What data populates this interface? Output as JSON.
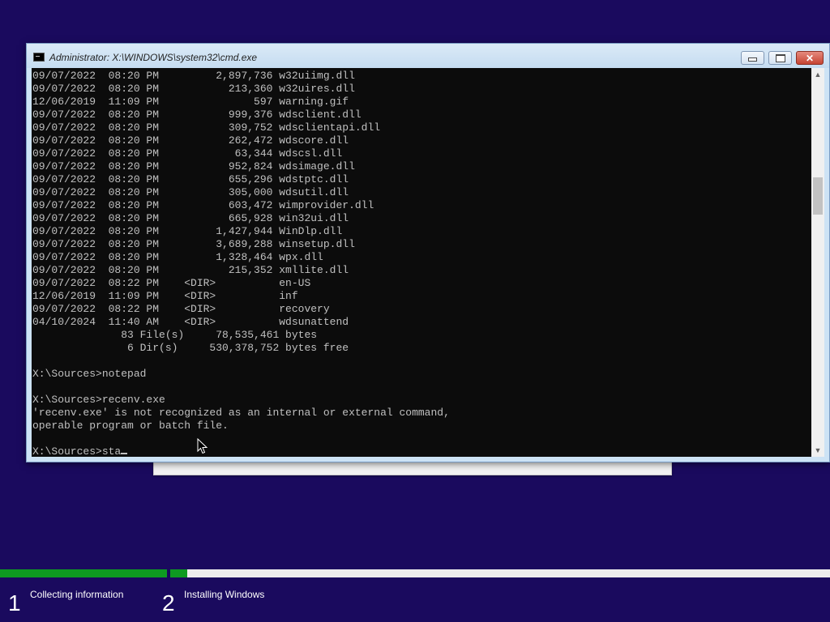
{
  "window": {
    "title": "Administrator: X:\\WINDOWS\\system32\\cmd.exe",
    "minimize_label": "",
    "close_label": "✕"
  },
  "console": {
    "lines": [
      "09/07/2022  08:20 PM         2,897,736 w32uiimg.dll",
      "09/07/2022  08:20 PM           213,360 w32uires.dll",
      "12/06/2019  11:09 PM               597 warning.gif",
      "09/07/2022  08:20 PM           999,376 wdsclient.dll",
      "09/07/2022  08:20 PM           309,752 wdsclientapi.dll",
      "09/07/2022  08:20 PM           262,472 wdscore.dll",
      "09/07/2022  08:20 PM            63,344 wdscsl.dll",
      "09/07/2022  08:20 PM           952,824 wdsimage.dll",
      "09/07/2022  08:20 PM           655,296 wdstptc.dll",
      "09/07/2022  08:20 PM           305,000 wdsutil.dll",
      "09/07/2022  08:20 PM           603,472 wimprovider.dll",
      "09/07/2022  08:20 PM           665,928 win32ui.dll",
      "09/07/2022  08:20 PM         1,427,944 WinDlp.dll",
      "09/07/2022  08:20 PM         3,689,288 winsetup.dll",
      "09/07/2022  08:20 PM         1,328,464 wpx.dll",
      "09/07/2022  08:20 PM           215,352 xmllite.dll",
      "09/07/2022  08:22 PM    <DIR>          en-US",
      "12/06/2019  11:09 PM    <DIR>          inf",
      "09/07/2022  08:22 PM    <DIR>          recovery",
      "04/10/2024  11:40 AM    <DIR>          wdsunattend",
      "              83 File(s)     78,535,461 bytes",
      "               6 Dir(s)     530,378,752 bytes free",
      "",
      "X:\\Sources>notepad",
      "",
      "X:\\Sources>recenv.exe",
      "'recenv.exe' is not recognized as an internal or external command,",
      "operable program or batch file.",
      "",
      "X:\\Sources>sta"
    ]
  },
  "scrollbar": {
    "up_arrow": "▲",
    "down_arrow": "▼"
  },
  "setup_progress": {
    "fraction_complete": 0.225,
    "steps": [
      {
        "number": "1",
        "label": "Collecting information"
      },
      {
        "number": "2",
        "label": "Installing Windows"
      }
    ]
  },
  "colors": {
    "desktop_background": "#1a0a5e",
    "progress_fill": "#0e9a21",
    "console_background": "#0c0c0c",
    "console_text": "#c0c0c0"
  }
}
